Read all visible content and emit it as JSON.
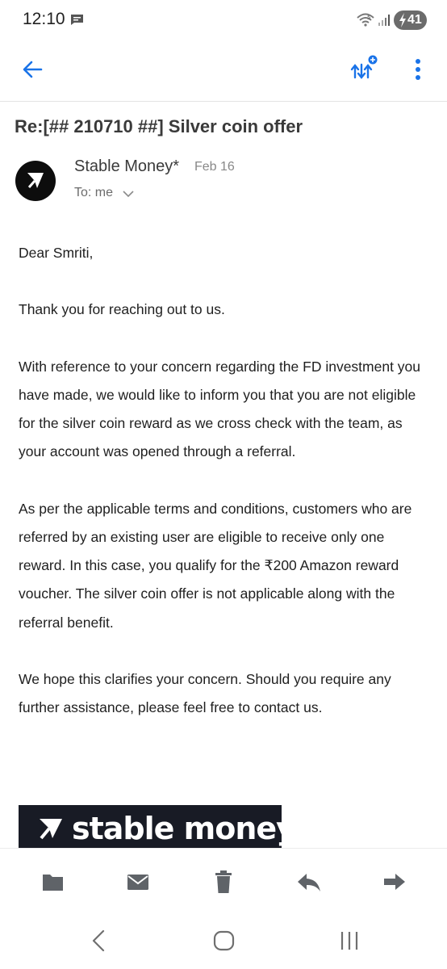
{
  "status_bar": {
    "time": "12:10",
    "battery_level": "41"
  },
  "app_bar": {
    "back_icon": "arrow-left-icon",
    "sort_icon": "sort-spark-icon",
    "more_icon": "more-vert-icon"
  },
  "email": {
    "subject": "Re:[## 210710 ##] Silver coin offer",
    "sender": "Stable Money*",
    "date": "Feb 16",
    "recipient_line": "To: me",
    "paragraphs": [
      "Dear Smriti,",
      "Thank you for reaching out to us.",
      "With reference to your concern regarding the FD investment you have made, we would like to inform you that you are not eligible for the silver coin reward as we cross check with the team, as your account was opened through a referral.",
      "As per the applicable terms and conditions, customers who are referred by an existing user are eligible to receive only one reward. In this case, you qualify for the ₹200 Amazon reward voucher. The silver coin offer is not applicable along with the referral benefit.",
      "We hope this clarifies your concern. Should you require any further assistance, please feel free to contact us."
    ],
    "logo_text": "stable money"
  },
  "actions": [
    "archive-icon",
    "mail-icon",
    "delete-icon",
    "reply-icon",
    "forward-icon"
  ],
  "navigation": [
    "back-nav-icon",
    "home-nav-icon",
    "recents-nav-icon"
  ],
  "colors": {
    "accent": "#1a73e8",
    "icon_gray": "#5f6368",
    "banner_bg": "#181b25"
  }
}
